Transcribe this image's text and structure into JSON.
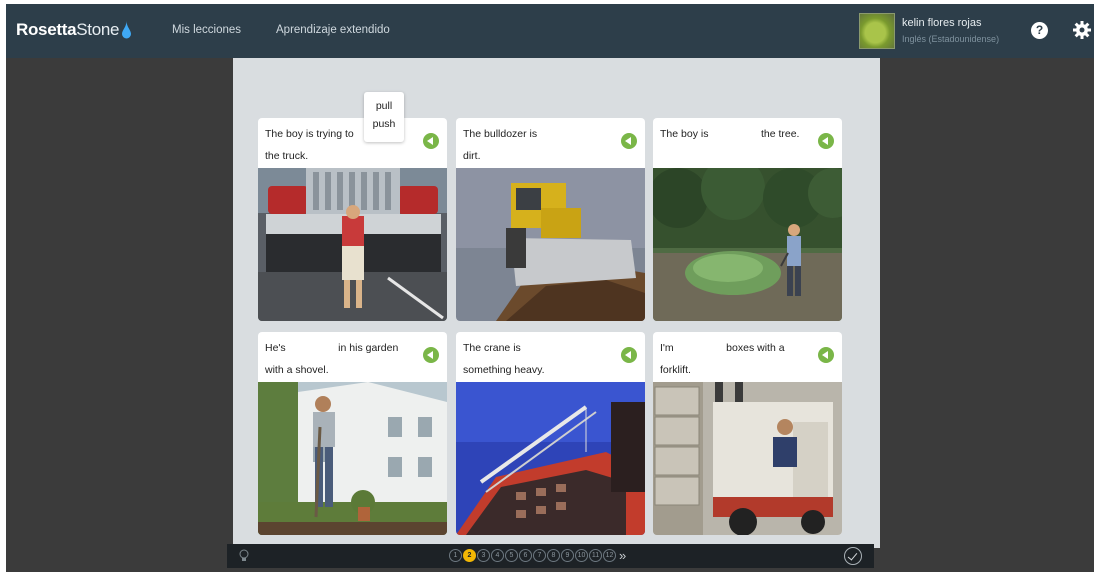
{
  "header": {
    "logo_word1": "Rosetta",
    "logo_word2": "Stone",
    "nav": [
      "Mis lecciones",
      "Aprendizaje extendido"
    ],
    "user_name": "kelin flores rojas",
    "user_language": "Inglés (Estadounidense)",
    "help_label": "?"
  },
  "word_choices": [
    "pull",
    "push"
  ],
  "cards": [
    {
      "line1": "The boy is trying to ",
      "line2": "the truck.",
      "photo": "boy pushing a truck"
    },
    {
      "line1": "The bulldozer is",
      "line2": "dirt.",
      "photo": "bulldozer pushing dirt"
    },
    {
      "line1": "The boy is                  the tree.",
      "line2": "",
      "photo": "boy pulling a tree"
    },
    {
      "line1": "He's                  in his garden",
      "line2": "with a shovel.",
      "photo": "man digging with a shovel"
    },
    {
      "line1": "The crane is",
      "line2": "something heavy.",
      "photo": "crane lifting something"
    },
    {
      "line1": "I'm                  boxes with a",
      "line2": "forklift.",
      "photo": "man driving a forklift"
    }
  ],
  "progress": {
    "current": 2,
    "steps": [
      "1",
      "2",
      "3",
      "4",
      "5",
      "6",
      "7",
      "8",
      "9",
      "10",
      "11",
      "12"
    ],
    "more": "»"
  },
  "colors": {
    "topbar": "#2d3e4a",
    "accent_green": "#7ab648",
    "current_step": "#f2b705"
  }
}
